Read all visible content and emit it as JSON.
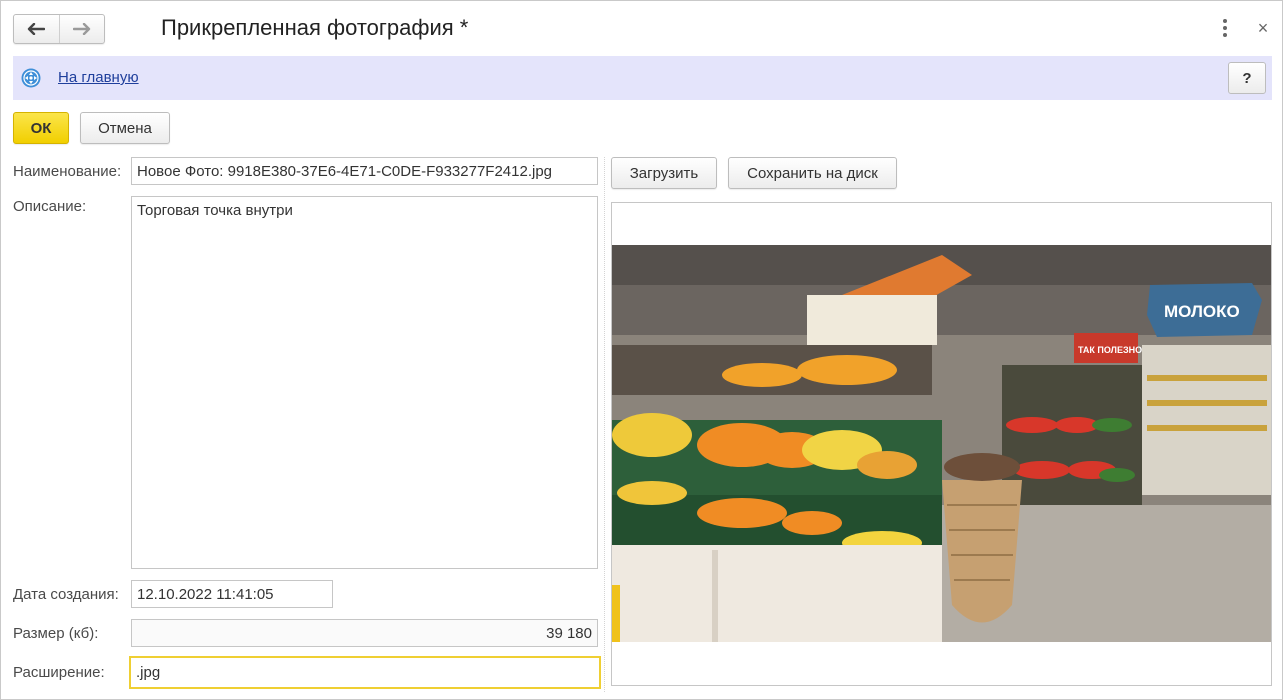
{
  "window": {
    "title": "Прикрепленная фотография *",
    "nav": {
      "back_icon": "arrow-left-icon",
      "forward_icon": "arrow-right-icon"
    },
    "menu_icon": "more-vertical-icon",
    "close_label": "×"
  },
  "infobar": {
    "home_icon": "home-navigation-icon",
    "home_link": "На главную",
    "help_label": "?"
  },
  "actions": {
    "ok_label": "ОК",
    "cancel_label": "Отмена"
  },
  "form": {
    "name_label": "Наименование:",
    "name_value": "Новое Фото: 9918E380-37E6-4E71-C0DE-F933277F2412.jpg",
    "description_label": "Описание:",
    "description_value": "Торговая точка внутри",
    "created_label": "Дата создания:",
    "created_value": "12.10.2022 11:41:05",
    "size_label": "Размер (кб):",
    "size_value": "39 180",
    "extension_label": "Расширение:",
    "extension_value": ".jpg"
  },
  "picture": {
    "upload_label": "Загрузить",
    "save_label": "Сохранить на диск",
    "sign_large": "МОЛОКО",
    "sign_promo": "ТАК ПОЛЕЗНО"
  },
  "colors": {
    "infobar_bg": "#e4e4fb",
    "ok_button": "#f3d413",
    "link": "#1f3f9c",
    "active_field_border": "#efcf33"
  }
}
